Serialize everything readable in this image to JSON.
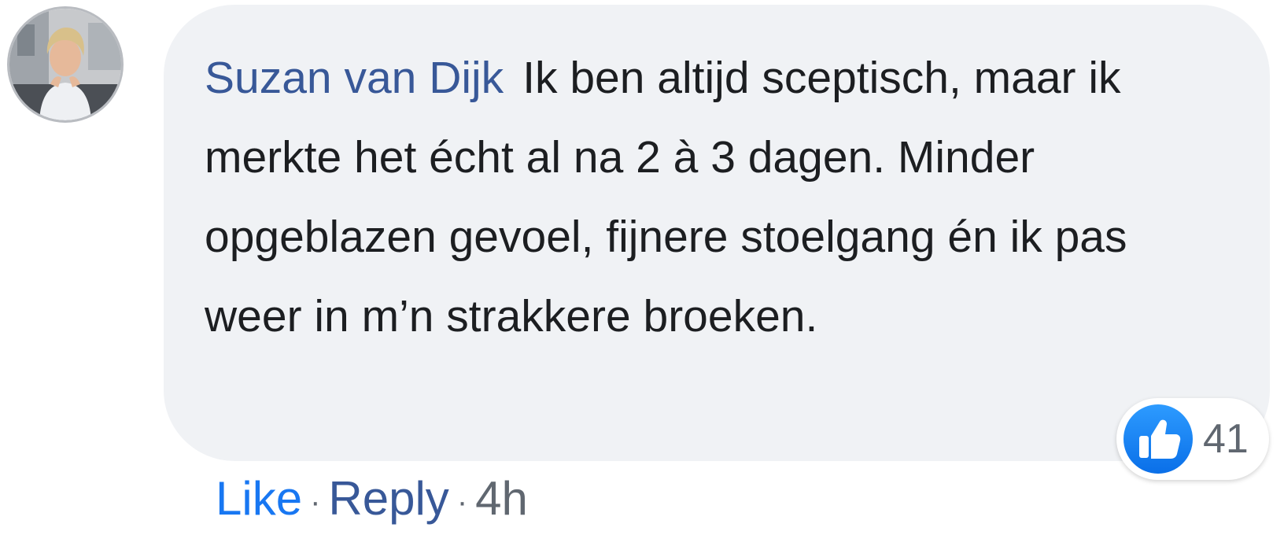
{
  "comment": {
    "author": "Suzan van Dijk",
    "text": "Ik ben altijd sceptisch, maar ik merkte het écht al na 2 à 3 dagen. Minder opgeblazen gevoel, fijnere stoelgang én ik pas weer in m’n strakkere broeken.",
    "avatar_icon": "user-avatar-photo"
  },
  "reactions": {
    "icon": "thumbs-up-icon",
    "count": "41",
    "accent_color": "#1877f2"
  },
  "actions": {
    "like_label": "Like",
    "reply_label": "Reply",
    "separator": "·",
    "timestamp": "4h"
  },
  "colors": {
    "author": "#385898",
    "bubble_bg": "#f0f2f5",
    "text": "#1c1e21",
    "meta": "#606770"
  }
}
